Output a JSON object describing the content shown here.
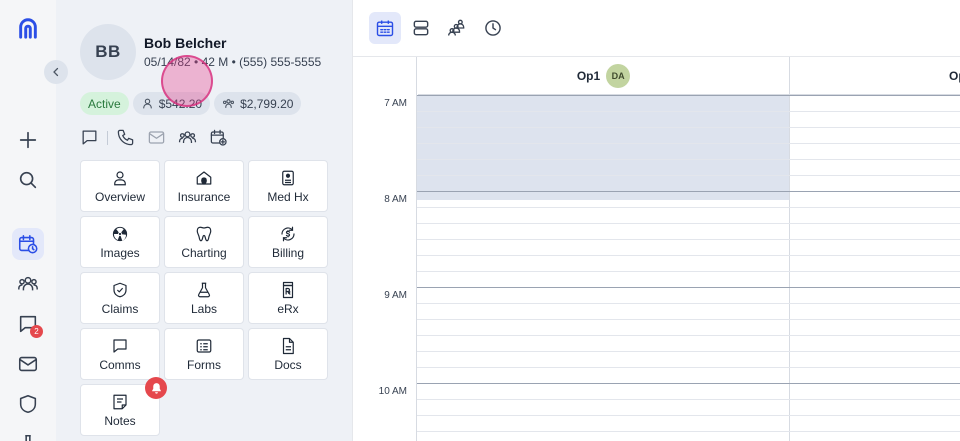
{
  "rail": {
    "items": [
      {
        "name": "app-logo",
        "icon": "logo-icon"
      },
      {
        "name": "add",
        "icon": "plus-icon"
      },
      {
        "name": "search",
        "icon": "search-icon"
      },
      {
        "name": "schedule",
        "icon": "calendar-clock-icon",
        "active": true
      },
      {
        "name": "patients",
        "icon": "people-icon"
      },
      {
        "name": "messages",
        "icon": "chat-icon",
        "badge": "2"
      },
      {
        "name": "mail",
        "icon": "mail-icon"
      },
      {
        "name": "security",
        "icon": "shield-icon"
      },
      {
        "name": "labs",
        "icon": "flask-icon"
      }
    ]
  },
  "patient": {
    "initials": "BB",
    "name": "Bob Belcher",
    "meta": "05/14/82 • 42 M • (555) 555-5555",
    "status": "Active",
    "patient_balance": "$542.20",
    "family_balance": "$2,799.20"
  },
  "actions": [
    "chat-icon",
    "phone-icon",
    "mail-icon",
    "family-icon",
    "calendar-add-icon"
  ],
  "tiles": [
    {
      "label": "Overview",
      "icon": "person-icon"
    },
    {
      "label": "Insurance",
      "icon": "insurance-house-icon"
    },
    {
      "label": "Med Hx",
      "icon": "clipboard-icon"
    },
    {
      "label": "Images",
      "icon": "radiation-icon"
    },
    {
      "label": "Charting",
      "icon": "tooth-icon"
    },
    {
      "label": "Billing",
      "icon": "dollar-refresh-icon"
    },
    {
      "label": "Claims",
      "icon": "shield-check-icon"
    },
    {
      "label": "Labs",
      "icon": "flask-icon"
    },
    {
      "label": "eRx",
      "icon": "rx-icon"
    },
    {
      "label": "Comms",
      "icon": "chat-icon"
    },
    {
      "label": "Forms",
      "icon": "form-icon"
    },
    {
      "label": "Docs",
      "icon": "document-icon"
    },
    {
      "label": "Notes",
      "icon": "notes-icon"
    }
  ],
  "toolbar": {
    "views": [
      "calendar-view-icon",
      "rows-view-icon",
      "providers-view-icon",
      "clock-view-icon"
    ]
  },
  "schedule": {
    "columns": [
      {
        "label": "Op1",
        "badge": "DA"
      },
      {
        "label": "Op"
      }
    ],
    "times": [
      "7 AM",
      "8 AM",
      "9 AM",
      "10 AM"
    ]
  },
  "colors": {
    "accent": "#2b4ee6",
    "active_chip_bg": "#d5f2dc",
    "active_chip_text": "#2a7a3e",
    "alert": "#e5484d",
    "blocked_slot": "#dde3ee"
  }
}
